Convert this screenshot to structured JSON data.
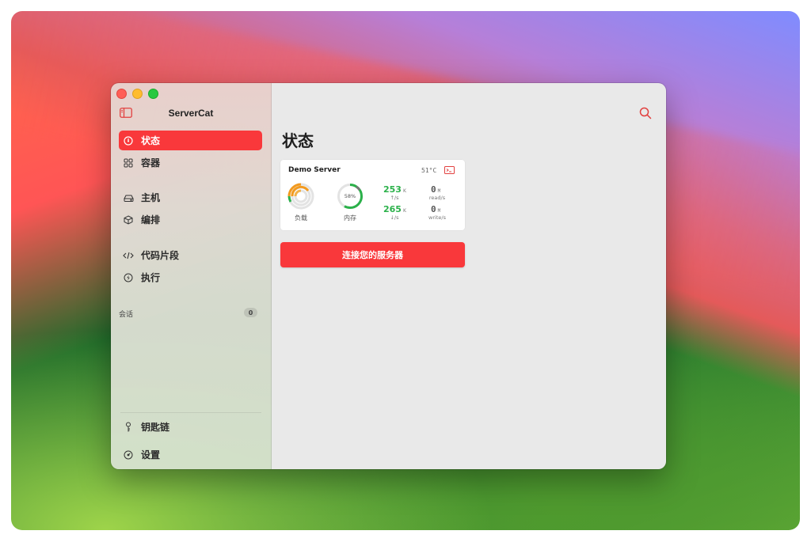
{
  "app": {
    "title": "ServerCat"
  },
  "sidebar": {
    "items": [
      {
        "label": "状态",
        "icon": "status-gauge-icon",
        "active": true
      },
      {
        "label": "容器",
        "icon": "containers-grid-icon",
        "active": false
      },
      {
        "label": "主机",
        "icon": "host-drive-icon",
        "active": false
      },
      {
        "label": "编排",
        "icon": "orchestration-cube-icon",
        "active": false
      },
      {
        "label": "代码片段",
        "icon": "code-snippet-icon",
        "active": false
      },
      {
        "label": "执行",
        "icon": "execute-bolt-icon",
        "active": false
      }
    ],
    "sessions": {
      "label": "会话",
      "count": "0"
    },
    "bottom_items": [
      {
        "label": "钥匙链",
        "icon": "keychain-key-icon"
      },
      {
        "label": "设置",
        "icon": "settings-gauge-icon"
      }
    ]
  },
  "main": {
    "title": "状态",
    "server_card": {
      "name": "Demo Server",
      "temperature": "51°C",
      "load": {
        "label": "负载"
      },
      "memory": {
        "label": "内存",
        "percent_text": "58%",
        "percent": 58
      },
      "net_up": {
        "value": "253",
        "unit": "K",
        "sub": "↑/s"
      },
      "net_down": {
        "value": "265",
        "unit": "K",
        "sub": "↓/s"
      },
      "disk_read": {
        "value": "0",
        "unit": "M",
        "sub": "read/s"
      },
      "disk_write": {
        "value": "0",
        "unit": "M",
        "sub": "write/s"
      }
    },
    "connect_button": "连接您的服务器"
  },
  "colors": {
    "accent": "#f9383b",
    "green": "#2bb14a",
    "orange": "#f29a1f"
  }
}
